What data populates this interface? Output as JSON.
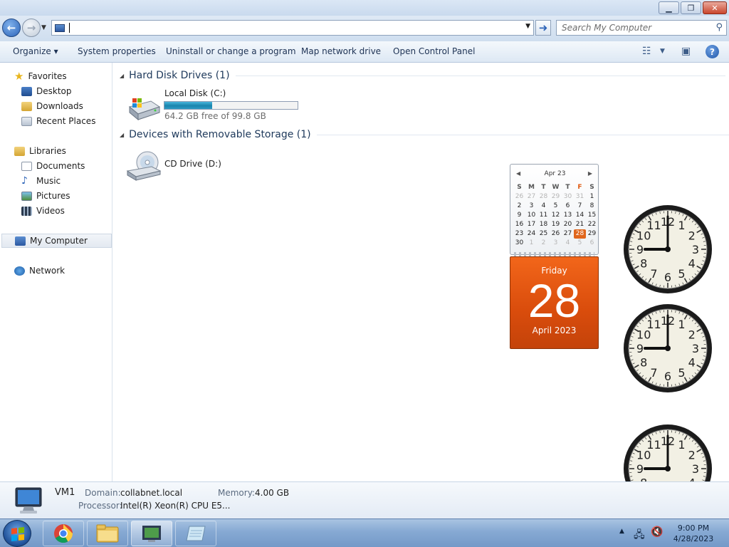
{
  "window": {
    "minimize": "▁",
    "maximize": "❐",
    "close": "✕"
  },
  "navbar": {
    "address_value": "",
    "search_placeholder": "Search My Computer"
  },
  "commandbar": {
    "organize": "Organize ▾",
    "system_properties": "System properties",
    "uninstall": "Uninstall or change a program",
    "map_drive": "Map network drive",
    "control_panel": "Open Control Panel"
  },
  "sidebar": {
    "favorites": "Favorites",
    "desktop": "Desktop",
    "downloads": "Downloads",
    "recent": "Recent Places",
    "libraries": "Libraries",
    "documents": "Documents",
    "music": "Music",
    "pictures": "Pictures",
    "videos": "Videos",
    "my_computer": "My Computer",
    "network": "Network"
  },
  "content": {
    "hdd_header": "Hard Disk Drives (1)",
    "local_disk_name": "Local Disk (C:)",
    "local_disk_free": "64.2 GB free of 99.8 GB",
    "local_disk_used_fraction": 0.357,
    "removable_header": "Devices with Removable Storage (1)",
    "cd_drive_name": "CD Drive (D:)"
  },
  "calendar_gadget": {
    "month_label": "Apr 23",
    "weekday_headers": [
      "S",
      "M",
      "T",
      "W",
      "T",
      "F",
      "S"
    ],
    "weeks": [
      [
        "26",
        "27",
        "28",
        "29",
        "30",
        "31",
        "1"
      ],
      [
        "2",
        "3",
        "4",
        "5",
        "6",
        "7",
        "8"
      ],
      [
        "9",
        "10",
        "11",
        "12",
        "13",
        "14",
        "15"
      ],
      [
        "16",
        "17",
        "18",
        "19",
        "20",
        "21",
        "22"
      ],
      [
        "23",
        "24",
        "25",
        "26",
        "27",
        "28",
        "29"
      ],
      [
        "30",
        "1",
        "2",
        "3",
        "4",
        "5",
        "6"
      ]
    ],
    "today": "28",
    "day_of_week": "Friday",
    "day": "28",
    "month_year": "April 2023"
  },
  "clock_gadget": {
    "hour": 9,
    "minute": 0,
    "numbers": [
      "12",
      "1",
      "2",
      "3",
      "4",
      "5",
      "6",
      "7",
      "8",
      "9",
      "10",
      "11"
    ]
  },
  "details": {
    "computer_name": "VM1",
    "domain_label": "Domain:",
    "domain_value": "collabnet.local",
    "memory_label": "Memory:",
    "memory_value": "4.00 GB",
    "processor_label": "Processor:",
    "processor_value": "Intel(R) Xeon(R) CPU E5..."
  },
  "taskbar": {
    "time": "9:00 PM",
    "date": "4/28/2023"
  },
  "colors": {
    "accent": "#1e395b",
    "calendar_orange": "#e0661c",
    "drive_fill": "#2e9bc5"
  }
}
